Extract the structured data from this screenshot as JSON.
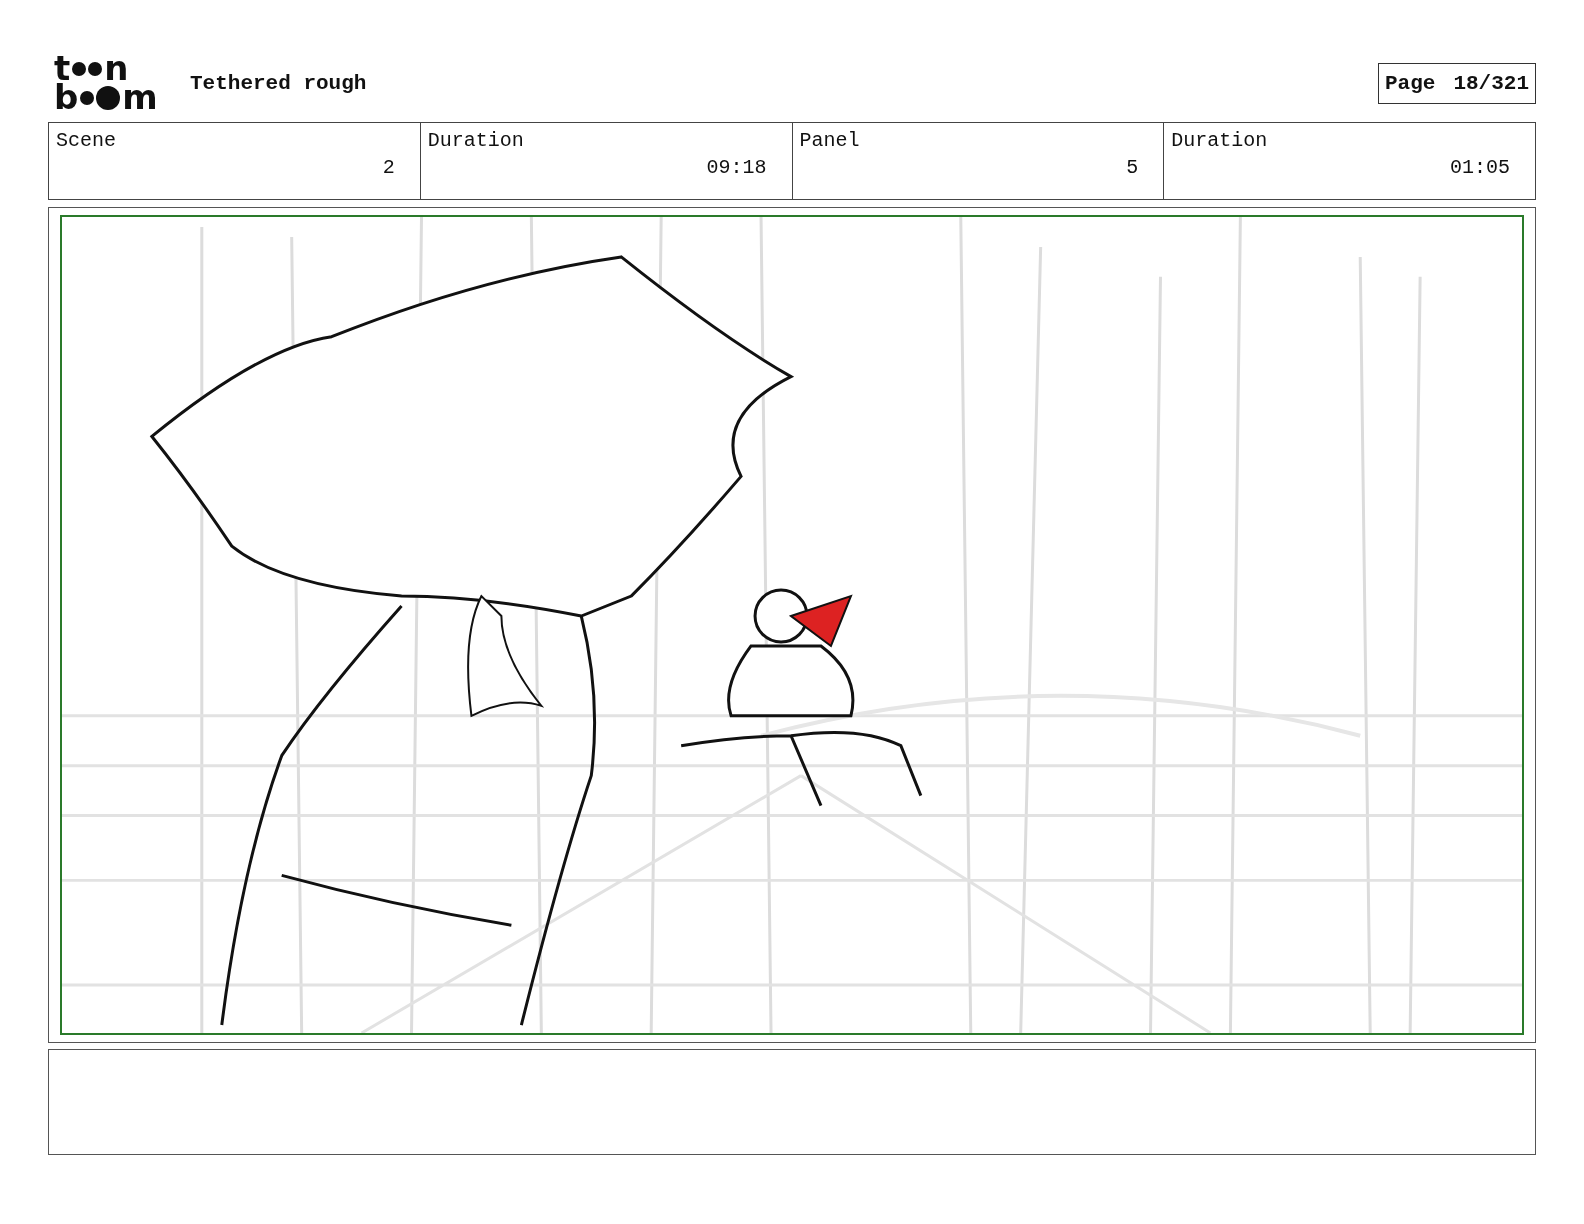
{
  "logo": {
    "top": [
      "t",
      "n"
    ],
    "bottom": [
      "b",
      "m"
    ]
  },
  "header": {
    "title": "Tethered rough",
    "page_label": "Page",
    "page_number": "18/321"
  },
  "info": [
    {
      "label": "Scene",
      "value": "2"
    },
    {
      "label": "Duration",
      "value": "09:18"
    },
    {
      "label": "Panel",
      "value": "5"
    },
    {
      "label": "Duration",
      "value": "01:05"
    }
  ]
}
